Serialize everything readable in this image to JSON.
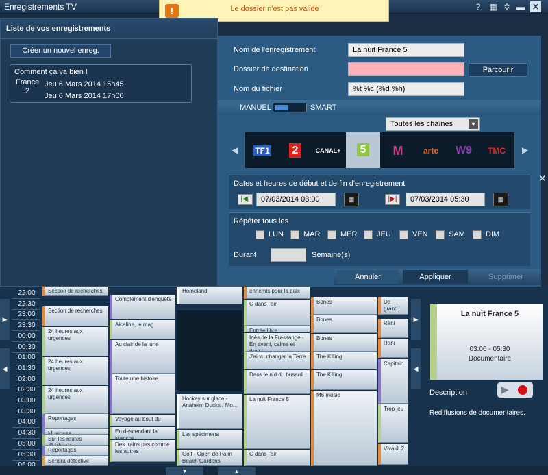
{
  "window": {
    "title": "Enregistrements TV"
  },
  "toast": {
    "message": "Le dossier n'est pas valide"
  },
  "left": {
    "header": "Liste de vos enregistrements",
    "create_label": "Créer un nouvel enreg.",
    "card": {
      "title": "Comment ça va bien !",
      "channel": "France 2",
      "start": "Jeu 6 Mars 2014 15h45",
      "end": "Jeu 6 Mars 2014 17h00"
    }
  },
  "form": {
    "name_label": "Nom de l'enregistrement",
    "name_value": "La nuit France 5",
    "dest_label": "Dossier de destination",
    "dest_value": "",
    "browse_label": "Parcourir",
    "file_label": "Nom du fichier",
    "file_value": "%t %c (%d %h)"
  },
  "mode": {
    "manual": "MANUEL",
    "smart": "SMART"
  },
  "channels_filter": "Toutes les chaînes",
  "channels": [
    {
      "name": "TF1",
      "color": "#ffffff"
    },
    {
      "name": "2",
      "color": "#e0231b"
    },
    {
      "name": "CANAL+",
      "color": "#ffffff"
    },
    {
      "name": "5",
      "color": "#8fc63f"
    },
    {
      "name": "M",
      "color": "#c83c8c"
    },
    {
      "name": "arte",
      "color": "#d8632a"
    },
    {
      "name": "W9",
      "color": "#8a3fb0"
    },
    {
      "name": "TMC",
      "color": "#d62a2a"
    }
  ],
  "dates": {
    "title": "Dates et heures de début et de fin d'enregistrement",
    "start": "07/03/2014 03:00",
    "end": "07/03/2014 05:30"
  },
  "repeat": {
    "title": "Répéter tous les",
    "days": [
      "LUN",
      "MAR",
      "MER",
      "JEU",
      "VEN",
      "SAM",
      "DIM"
    ]
  },
  "during": {
    "label": "Durant",
    "unit": "Semaine(s)"
  },
  "buttons": {
    "cancel": "Annuler",
    "apply": "Appliquer",
    "delete": "Supprimer"
  },
  "schedule": {
    "times": [
      "22:00",
      "22:30",
      "23:00",
      "23:30",
      "00:00",
      "00:30",
      "01:00",
      "01:30",
      "02:00",
      "02:30",
      "03:00",
      "03:30",
      "04:00",
      "04:30",
      "05:00",
      "05:30",
      "06:00"
    ],
    "col1": [
      "Section de recherches",
      "Section de recherches",
      "24 heures aux urgences",
      "24 heures aux urgences",
      "24 heures aux urgences",
      "Reportages",
      "Musiques",
      "Sur les routes d'Ushuaia",
      "Reportages",
      "Sendra détective"
    ],
    "col2": [
      "Complément d'enquête",
      "Alcaline, le mag",
      "Au clair de la lune",
      "Toute une histoire",
      "Voyage au bout du",
      "En descendant la Manche",
      "Des trains pas comme les autres"
    ],
    "col3": [
      "Homeland",
      "Hockey sur glace - Anaheim Ducks / Mo...",
      "Les spécimens",
      "Golf - Open de Palm Beach Gardens"
    ],
    "col4": [
      "ennemis pour la paix",
      "C dans l'air",
      "Entrée libre",
      "Inès de la Fressange - En avant, calme et droit !",
      "J'ai vu changer la Terre",
      "Dans le nid du busard",
      "La nuit France 5",
      "C dans l'air"
    ],
    "col5": [
      "Bones",
      "Bones",
      "Bones",
      "The Killing",
      "The Killing",
      "M6 music"
    ],
    "col6": [
      "De grand",
      "Rani",
      "Rani",
      "Capitain",
      "Trop jeu",
      "Vivaldi 2"
    ]
  },
  "detail": {
    "title": "La nuit France 5",
    "time": "03:00 - 05:30",
    "genre": "Documentaire",
    "desc_label": "Description",
    "desc_text": "Rediffusions de documentaires."
  }
}
